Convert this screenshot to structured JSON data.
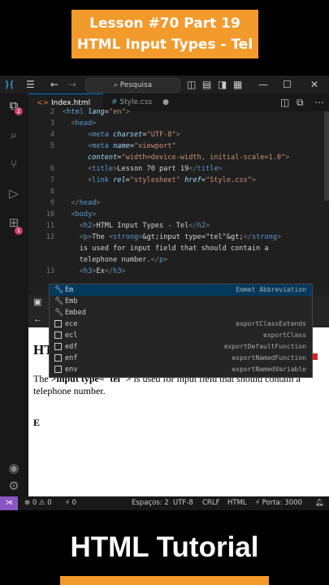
{
  "banner": {
    "line1": "Lesson #70 Part 19",
    "line2": "HTML Input Types - Tel"
  },
  "titlebar": {
    "search_placeholder": "Pesquisa"
  },
  "activity": {
    "explorer_badge": "2",
    "extensions_badge": "1"
  },
  "tabs": [
    {
      "label": "Index.html",
      "dot": "●"
    },
    {
      "label": "Style.css",
      "dot": "●"
    }
  ],
  "editor": {
    "lines": [
      {
        "n": "2",
        "code": [
          [
            "pu",
            "<"
          ],
          [
            "tg",
            "html"
          ],
          [
            "at",
            " lang"
          ],
          [
            "tx",
            "="
          ],
          [
            "st",
            "\"en\""
          ],
          [
            "pu",
            ">"
          ]
        ]
      },
      {
        "n": "3",
        "code": [
          [
            "tx",
            "  "
          ],
          [
            "pu",
            "<"
          ],
          [
            "tg",
            "head"
          ],
          [
            "pu",
            ">"
          ]
        ]
      },
      {
        "n": "4",
        "code": [
          [
            "tx",
            "      "
          ],
          [
            "pu",
            "<"
          ],
          [
            "tg",
            "meta"
          ],
          [
            "at",
            " charset"
          ],
          [
            "tx",
            "="
          ],
          [
            "st",
            "\"UTF-8\""
          ],
          [
            "pu",
            ">"
          ]
        ]
      },
      {
        "n": "5",
        "code": [
          [
            "tx",
            "      "
          ],
          [
            "pu",
            "<"
          ],
          [
            "tg",
            "meta"
          ],
          [
            "at",
            " name"
          ],
          [
            "tx",
            "="
          ],
          [
            "st",
            "\"viewport\""
          ]
        ]
      },
      {
        "n": "",
        "code": [
          [
            "tx",
            "      "
          ],
          [
            "at",
            "content"
          ],
          [
            "tx",
            "="
          ],
          [
            "st",
            "\"width=device-width, initial-scale=1.0\""
          ],
          [
            "pu",
            ">"
          ]
        ]
      },
      {
        "n": "6",
        "code": [
          [
            "tx",
            "      "
          ],
          [
            "pu",
            "<"
          ],
          [
            "tg",
            "title"
          ],
          [
            "pu",
            ">"
          ],
          [
            "tx",
            "Lesson 70 part 19"
          ],
          [
            "pu",
            "</"
          ],
          [
            "tg",
            "title"
          ],
          [
            "pu",
            ">"
          ]
        ]
      },
      {
        "n": "7",
        "code": [
          [
            "tx",
            "      "
          ],
          [
            "pu",
            "<"
          ],
          [
            "tg",
            "link"
          ],
          [
            "at",
            " rel"
          ],
          [
            "tx",
            "="
          ],
          [
            "st",
            "\"stylesheet\""
          ],
          [
            "at",
            " href"
          ],
          [
            "tx",
            "="
          ],
          [
            "st",
            "\"Style.css\""
          ],
          [
            "pu",
            ">"
          ]
        ]
      },
      {
        "n": "8",
        "code": []
      },
      {
        "n": "9",
        "code": [
          [
            "tx",
            "  "
          ],
          [
            "pu",
            "</"
          ],
          [
            "tg",
            "head"
          ],
          [
            "pu",
            ">"
          ]
        ]
      },
      {
        "n": "10",
        "code": [
          [
            "tx",
            "  "
          ],
          [
            "pu",
            "<"
          ],
          [
            "tg",
            "body"
          ],
          [
            "pu",
            ">"
          ]
        ]
      },
      {
        "n": "11",
        "code": [
          [
            "tx",
            "    "
          ],
          [
            "pu",
            "<"
          ],
          [
            "tg",
            "h2"
          ],
          [
            "pu",
            ">"
          ],
          [
            "tx",
            "HTML Input Types - Tel"
          ],
          [
            "pu",
            "</"
          ],
          [
            "tg",
            "h2"
          ],
          [
            "pu",
            ">"
          ]
        ]
      },
      {
        "n": "12",
        "code": [
          [
            "tx",
            "    "
          ],
          [
            "pu",
            "<"
          ],
          [
            "tg",
            "p"
          ],
          [
            "pu",
            ">"
          ],
          [
            "tx",
            "The "
          ],
          [
            "pu",
            "<"
          ],
          [
            "tg",
            "strong"
          ],
          [
            "pu",
            ">"
          ],
          [
            "tx",
            "&gt;input type=\"tel\"&gt;"
          ],
          [
            "pu",
            "</"
          ],
          [
            "tg",
            "strong"
          ],
          [
            "pu",
            ">"
          ]
        ]
      },
      {
        "n": "",
        "code": [
          [
            "tx",
            "    is used for input field that should contain a"
          ]
        ]
      },
      {
        "n": "",
        "code": [
          [
            "tx",
            "    telephone number."
          ],
          [
            "pu",
            "</"
          ],
          [
            "tg",
            "p"
          ],
          [
            "pu",
            ">"
          ]
        ]
      },
      {
        "n": "13",
        "code": [
          [
            "tx",
            "    "
          ],
          [
            "pu",
            "<"
          ],
          [
            "tg",
            "h3"
          ],
          [
            "pu",
            ">"
          ],
          [
            "tx",
            "Ex"
          ],
          [
            "pu",
            "</"
          ],
          [
            "tg",
            "h3"
          ],
          [
            "pu",
            ">"
          ]
        ]
      }
    ]
  },
  "suggestions": [
    {
      "icon": "wrench",
      "label": "Em",
      "detail": "Emmet Abbreviation"
    },
    {
      "icon": "wrench",
      "label": "Emb",
      "detail": ""
    },
    {
      "icon": "wrench",
      "label": "Embed",
      "detail": ""
    },
    {
      "icon": "box",
      "label": "ece",
      "detail": "exportClassExtends"
    },
    {
      "icon": "box",
      "label": "ecl",
      "detail": "exportClass"
    },
    {
      "icon": "box",
      "label": "edf",
      "detail": "exportDefaultFunction"
    },
    {
      "icon": "box",
      "label": "enf",
      "detail": "exportNamedFunction"
    },
    {
      "icon": "box",
      "label": "env",
      "detail": "exportNamedVariable"
    }
  ],
  "preview": {
    "heading_partial": "HT",
    "para_prefix": "The ",
    "para_strong": ">input type=\"tel\">",
    "para_suffix": " is used for input field that should contain a telephone number.",
    "h3_partial": "E"
  },
  "statusbar": {
    "errors": "⊗ 0 ⚠ 0",
    "ports": "⚡ 0",
    "spaces": "Espaços: 2",
    "encoding": "UTF-8",
    "eol": "CRLF",
    "language": "HTML",
    "port": "⚡ Porta: 3000"
  },
  "footer": {
    "title": "HTML Tutorial"
  },
  "colors": {
    "accent": "#f39a2c",
    "vscode_blue": "#0078d4",
    "selection": "#04395e"
  }
}
